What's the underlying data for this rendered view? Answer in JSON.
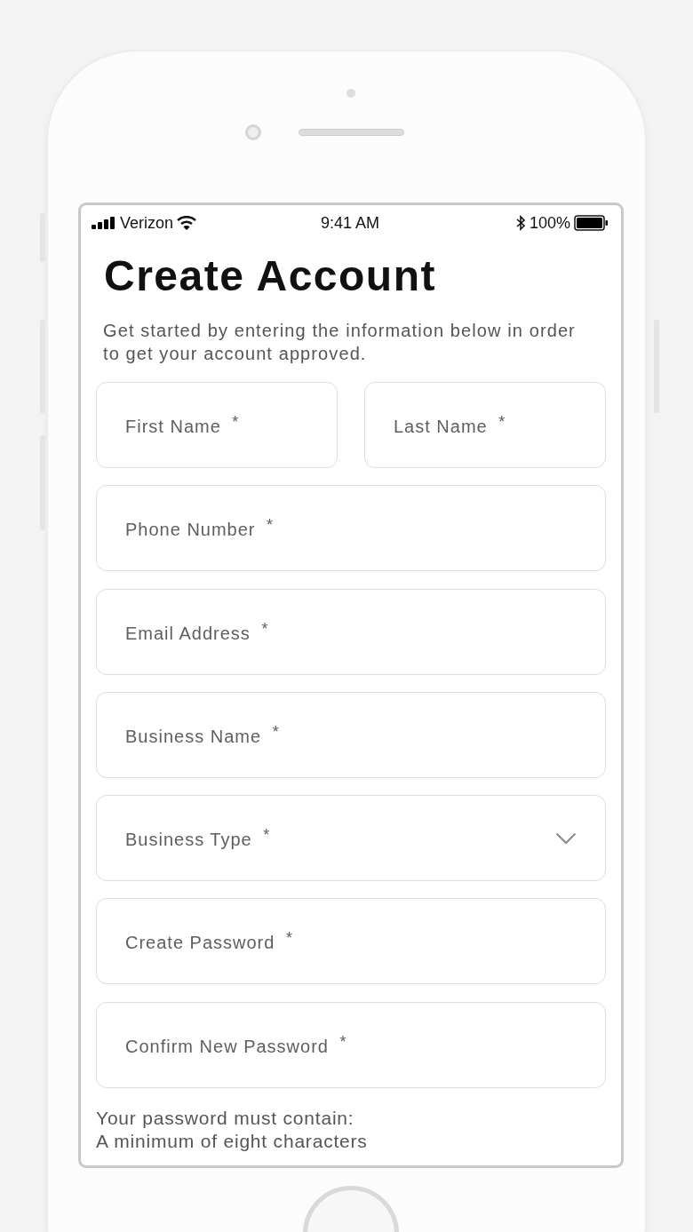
{
  "status_bar": {
    "carrier": "Verizon",
    "time": "9:41 AM",
    "battery": "100%"
  },
  "title": "Create Account",
  "subtitle": "Get started by entering the information below in order to get your account approved.",
  "field_rows": [
    {
      "fields": [
        {
          "kind": "text",
          "label": "First Name $^{*}$"
        },
        {
          "kind": "text",
          "label": "Last Name $^{*}$"
        }
      ]
    },
    {
      "fields": [
        {
          "kind": "text",
          "label": "Phone Number $^{*}$"
        }
      ]
    },
    {
      "fields": [
        {
          "kind": "text",
          "label": "Email Address $^{*}$"
        }
      ]
    },
    {
      "fields": [
        {
          "kind": "text",
          "label": "Business Name $^{*}$"
        }
      ]
    },
    {
      "fields": [
        {
          "kind": "select",
          "label": "Business Type $^{*}$"
        }
      ]
    },
    {
      "fields": [
        {
          "kind": "text",
          "label": "Create Password $^{*}$"
        }
      ]
    },
    {
      "fields": [
        {
          "kind": "text",
          "label": "Confirm New Password $^{*}$"
        }
      ]
    }
  ],
  "password_rules": [
    "Your password must contain:",
    "A minimum of eight characters"
  ]
}
